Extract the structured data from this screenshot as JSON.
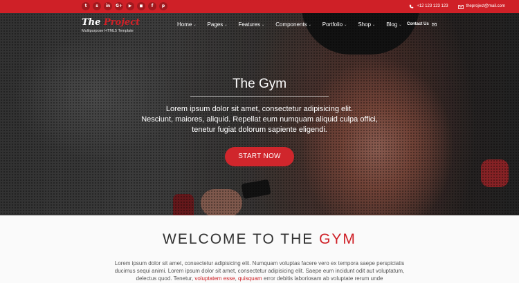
{
  "topbar": {
    "social": [
      "t",
      "s",
      "in",
      "G+",
      "▶",
      "◼",
      "f",
      "p"
    ],
    "phone": "+12 123 123 123",
    "email": "theproject@mail.com"
  },
  "logo": {
    "title_main": "The ",
    "title_accent": "Project",
    "subtitle": "Multipurpose HTML5 Template"
  },
  "nav": {
    "items": [
      "Home",
      "Pages",
      "Features",
      "Components",
      "Portfolio",
      "Shop",
      "Blog"
    ],
    "contact": "Contact Us"
  },
  "hero": {
    "title": "The Gym",
    "line1": "Lorem ipsum dolor sit amet, consectetur adipisicing elit.",
    "line2": "Nesciunt, maiores, aliquid. Repellat eum numquam aliquid culpa offici,",
    "line3": "tenetur fugiat dolorum sapiente eligendi.",
    "cta": "START NOW"
  },
  "welcome": {
    "title_main": "WELCOME TO THE ",
    "title_accent": "GYM",
    "text_1": "Lorem ipsum dolor sit amet, consectetur adipisicing elit. Numquam voluptas facere vero ex tempora saepe perspiciatis ducimus sequi animi. Lorem ipsum dolor sit amet, consectetur adipisicing elit. Saepe eum incidunt odit aut voluptatum, delectus quod. Tenetur, ",
    "link_1": "voluptatem esse",
    "sep": ", ",
    "link_2": "quisquam",
    "text_2": " error debitis laboriosam ab voluptate rerum unde"
  },
  "colors": {
    "accent": "#cf2027"
  }
}
